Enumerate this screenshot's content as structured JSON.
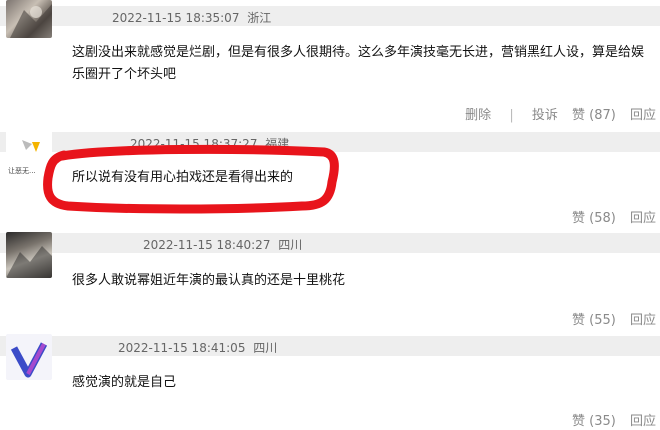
{
  "comments": [
    {
      "time": "2022-11-15 18:35:07",
      "location": "浙江",
      "text": "这剧没出来就感觉是烂剧，但是有很多人很期待。这么多年演技毫无长进，营销黑红人设，算是给娱乐圈开了个坏头吧",
      "delete_label": "删除",
      "divider": "|",
      "report_label": "投诉",
      "like_label": "赞",
      "like_count": "(87)",
      "reply_label": "回应"
    },
    {
      "time": "2022-11-15 18:37:27",
      "location": "福建",
      "avatar_text": "让恶无...",
      "text": "所以说有没有用心拍戏还是看得出来的",
      "like_label": "赞",
      "like_count": "(58)",
      "reply_label": "回应"
    },
    {
      "time": "2022-11-15 18:40:27",
      "location": "四川",
      "text": "很多人敢说幂姐近年演的最认真的还是十里桃花",
      "like_label": "赞",
      "like_count": "(55)",
      "reply_label": "回应"
    },
    {
      "time": "2022-11-15 18:41:05",
      "location": "四川",
      "text": "感觉演的就是自己",
      "like_label": "赞",
      "like_count": "(35)",
      "reply_label": "回应"
    }
  ],
  "colors": {
    "header_bg": "#eeeeee",
    "highlight": "#e8141b",
    "muted_text": "#8a8a8a"
  }
}
